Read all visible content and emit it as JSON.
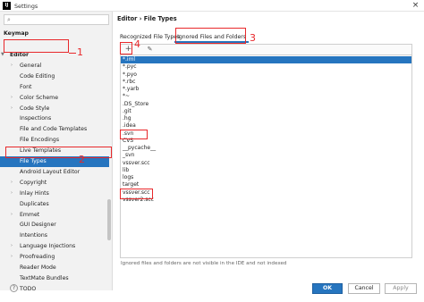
{
  "window": {
    "title": "Settings",
    "logo_text": "IJ"
  },
  "sidebar": {
    "items": [
      {
        "label": "Editor",
        "arrow": "▼",
        "bold": true
      },
      {
        "label": "General",
        "arrow": "›"
      },
      {
        "label": "Code Editing",
        "arrow": ""
      },
      {
        "label": "Font",
        "arrow": ""
      },
      {
        "label": "Color Scheme",
        "arrow": "›"
      },
      {
        "label": "Code Style",
        "arrow": "›"
      },
      {
        "label": "Inspections",
        "arrow": ""
      },
      {
        "label": "File and Code Templates",
        "arrow": ""
      },
      {
        "label": "File Encodings",
        "arrow": ""
      },
      {
        "label": "Live Templates",
        "arrow": ""
      },
      {
        "label": "File Types",
        "arrow": "",
        "selected": true
      },
      {
        "label": "Android Layout Editor",
        "arrow": ""
      },
      {
        "label": "Copyright",
        "arrow": "›"
      },
      {
        "label": "Inlay Hints",
        "arrow": "›"
      },
      {
        "label": "Duplicates",
        "arrow": ""
      },
      {
        "label": "Emmet",
        "arrow": "›"
      },
      {
        "label": "GUI Designer",
        "arrow": ""
      },
      {
        "label": "Intentions",
        "arrow": ""
      },
      {
        "label": "Language Injections",
        "arrow": "›"
      },
      {
        "label": "Proofreading",
        "arrow": "›"
      },
      {
        "label": "Reader Mode",
        "arrow": ""
      },
      {
        "label": "TextMate Bundles",
        "arrow": ""
      },
      {
        "label": "TODO",
        "arrow": ""
      }
    ],
    "keymap_label": "Keymap"
  },
  "main": {
    "breadcrumb": "Editor  ›  File Types",
    "tabs": [
      {
        "label": "Recognized File Types"
      },
      {
        "label": "Ignored Files and Folders",
        "active": true
      }
    ],
    "toolbar": {
      "add": "+",
      "edit": "✎"
    },
    "list": [
      "*.iml",
      "*.pyc",
      "*.pyo",
      "*.rbc",
      "*.yarb",
      "*~",
      ".DS_Store",
      ".git",
      ".hg",
      ".idea",
      ".svn",
      "CVS",
      "__pycache__",
      "_svn",
      "vssver.scc",
      "lib",
      "logs",
      "target",
      "vssver.scc",
      "vssver2.scc"
    ],
    "selected_index": 0,
    "note": "Ignored files and folders are not visible in the IDE and not indexed"
  },
  "footer": {
    "help": "?",
    "ok": "OK",
    "cancel": "Cancel",
    "apply": "Apply"
  },
  "annotations": {
    "n1": "1",
    "n2": "2",
    "n3": "3",
    "n4": "4"
  },
  "colors": {
    "accent": "#2675bf",
    "annotation": "#e8282b"
  }
}
